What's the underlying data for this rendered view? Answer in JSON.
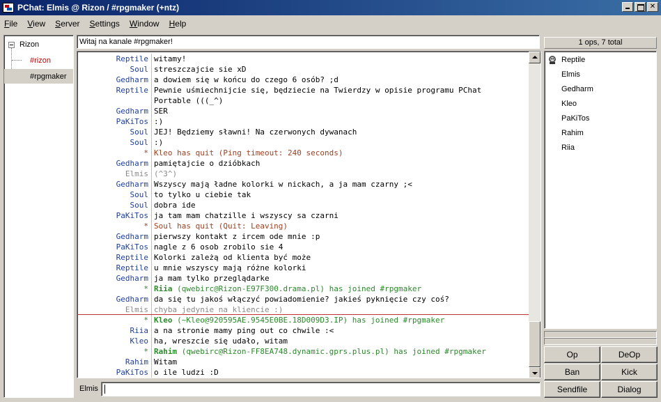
{
  "window": {
    "title": "PChat: Elmis @ Rizon / #rpgmaker (+ntz)"
  },
  "menu": [
    "File",
    "View",
    "Server",
    "Settings",
    "Window",
    "Help"
  ],
  "menu_underline": [
    "F",
    "V",
    "S",
    "S",
    "W",
    "H"
  ],
  "tree": {
    "server": "Rizon",
    "channels": [
      {
        "name": "#rizon",
        "color": "#c00000"
      },
      {
        "name": "#rpgmaker",
        "color": "#000000"
      }
    ]
  },
  "topic": "Witaj na kanale #rpgmaker!",
  "colors": {
    "blue": "#1f3fa0",
    "red": "#c00000",
    "brown": "#a04020",
    "green": "#2a8a2a",
    "gray": "#8a8a8a",
    "black": "#000000"
  },
  "chat": [
    {
      "nick": "Reptile",
      "nick_color": "#1f3fa0",
      "text": "witamy!",
      "text_color": "#000000"
    },
    {
      "nick": "Soul",
      "nick_color": "#1f3fa0",
      "text": "streszczajcie sie xD",
      "text_color": "#000000"
    },
    {
      "nick": "Gedharm",
      "nick_color": "#1f3fa0",
      "text": "a dowiem się w końcu do czego 6 osób? ;d",
      "text_color": "#000000"
    },
    {
      "nick": "Reptile",
      "nick_color": "#1f3fa0",
      "text": "Pewnie uśmiechnijcie się, będziecie na Twierdzy w opisie programu PChat",
      "text_color": "#000000"
    },
    {
      "nick": "",
      "nick_color": "#000000",
      "text": "Portable (((_^)",
      "text_color": "#000000"
    },
    {
      "nick": "Gedharm",
      "nick_color": "#1f3fa0",
      "text": "SER",
      "text_color": "#000000"
    },
    {
      "nick": "PaKiTos",
      "nick_color": "#1f3fa0",
      "text": ":)",
      "text_color": "#000000"
    },
    {
      "nick": "Soul",
      "nick_color": "#1f3fa0",
      "text": "JEJ! Będziemy sławni! Na czerwonych dywanach",
      "text_color": "#000000"
    },
    {
      "nick": "Soul",
      "nick_color": "#1f3fa0",
      "text": ":)",
      "text_color": "#000000"
    },
    {
      "nick": "*",
      "nick_color": "#a04020",
      "text": "Kleo has quit (Ping timeout: 240 seconds)",
      "text_color": "#a04020"
    },
    {
      "nick": "Gedharm",
      "nick_color": "#1f3fa0",
      "text": "pamiętajcie o dzióbkach",
      "text_color": "#000000"
    },
    {
      "nick": "Elmis",
      "nick_color": "#8a8a8a",
      "text": "(^3^)",
      "text_color": "#8a8a8a"
    },
    {
      "nick": "Gedharm",
      "nick_color": "#1f3fa0",
      "text": "Wszyscy mają ładne kolorki w nickach, a ja mam czarny ;<",
      "text_color": "#000000"
    },
    {
      "nick": "Soul",
      "nick_color": "#1f3fa0",
      "text": "to tylko u ciebie tak",
      "text_color": "#000000"
    },
    {
      "nick": "Soul",
      "nick_color": "#1f3fa0",
      "text": "dobra ide",
      "text_color": "#000000"
    },
    {
      "nick": "PaKiTos",
      "nick_color": "#1f3fa0",
      "text": "ja tam mam chatzille i wszyscy sa czarni",
      "text_color": "#000000"
    },
    {
      "nick": "*",
      "nick_color": "#a04020",
      "text": "Soul has quit (Quit: Leaving)",
      "text_color": "#a04020"
    },
    {
      "nick": "Gedharm",
      "nick_color": "#1f3fa0",
      "text": "pierwszy kontakt z ircem ode mnie :p",
      "text_color": "#000000"
    },
    {
      "nick": "PaKiTos",
      "nick_color": "#1f3fa0",
      "text": "nagle z 6 osob zrobilo sie 4",
      "text_color": "#000000"
    },
    {
      "nick": "Reptile",
      "nick_color": "#1f3fa0",
      "text": "Kolorki zależą od klienta być może",
      "text_color": "#000000"
    },
    {
      "nick": "Reptile",
      "nick_color": "#1f3fa0",
      "text": "u mnie wszyscy mają różne kolorki",
      "text_color": "#000000"
    },
    {
      "nick": "Gedharm",
      "nick_color": "#1f3fa0",
      "text": "ja mam tylko przeglądarke",
      "text_color": "#000000"
    },
    {
      "nick": "*",
      "nick_color": "#2a8a2a",
      "bold_part": "Riia",
      "text": " (qwebirc@Rizon-E97F300.drama.pl) has joined #rpgmaker",
      "text_color": "#2a8a2a"
    },
    {
      "nick": "Gedharm",
      "nick_color": "#1f3fa0",
      "text": "da się tu jakoś włączyć powiadomienie? jakieś pyknięcie czy coś?",
      "text_color": "#000000"
    },
    {
      "nick": "Elmis",
      "nick_color": "#8a8a8a",
      "text": "chyba jedynie na kliencie :)",
      "text_color": "#8a8a8a"
    },
    {
      "nick": "*",
      "nick_color": "#2a8a2a",
      "bold_part": "Kleo",
      "text": " (~Kleo@920595AE.9545E0BE.18D009D3.IP) has joined #rpgmaker",
      "text_color": "#2a8a2a"
    },
    {
      "nick": "Riia",
      "nick_color": "#1f3fa0",
      "text": "a na stronie mamy ping out co chwile :<",
      "text_color": "#000000"
    },
    {
      "nick": "Kleo",
      "nick_color": "#1f3fa0",
      "text": "ha, wreszcie się udało, witam",
      "text_color": "#000000"
    },
    {
      "nick": "*",
      "nick_color": "#2a8a2a",
      "bold_part": "Rahim",
      "text": " (qwebirc@Rizon-FF8EA748.dynamic.gprs.plus.pl) has joined #rpgmaker",
      "text_color": "#2a8a2a"
    },
    {
      "nick": "Rahim",
      "nick_color": "#1f3fa0",
      "text": "Witam",
      "text_color": "#000000"
    },
    {
      "nick": "PaKiTos",
      "nick_color": "#1f3fa0",
      "text": "o ile ludzi :D",
      "text_color": "#000000"
    }
  ],
  "input": {
    "nick": "Elmis",
    "value": ""
  },
  "users": {
    "summary": "1 ops, 7 total",
    "list": [
      {
        "name": "Reptile",
        "op": true
      },
      {
        "name": "Elmis",
        "op": false
      },
      {
        "name": "Gedharm",
        "op": false
      },
      {
        "name": "Kleo",
        "op": false
      },
      {
        "name": "PaKiTos",
        "op": false
      },
      {
        "name": "Rahim",
        "op": false
      },
      {
        "name": "Riia",
        "op": false
      }
    ]
  },
  "buttons": {
    "op": "Op",
    "deop": "DeOp",
    "ban": "Ban",
    "kick": "Kick",
    "sendfile": "Sendfile",
    "dialog": "Dialog"
  },
  "icons": {
    "app": "pchat-app-icon",
    "op": "op-bot-icon"
  }
}
